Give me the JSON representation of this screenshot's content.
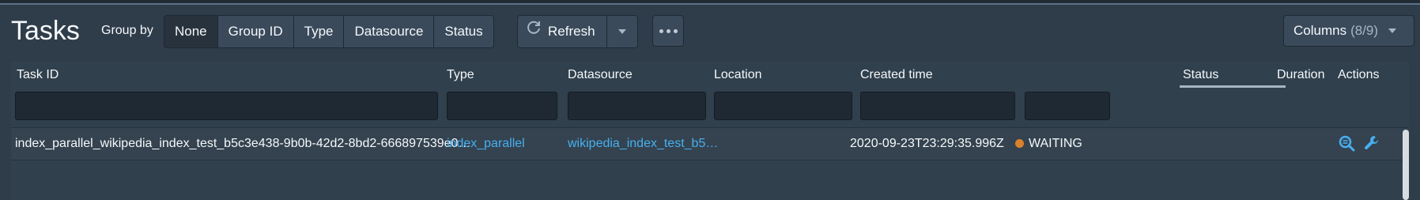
{
  "header": {
    "title": "Tasks",
    "group_by_label": "Group by",
    "group_by_options": [
      "None",
      "Group ID",
      "Type",
      "Datasource",
      "Status"
    ],
    "refresh_label": "Refresh",
    "columns_label": "Columns",
    "columns_count": "(8/9)"
  },
  "table": {
    "columns": [
      "Task ID",
      "Type",
      "Datasource",
      "Location",
      "Created time",
      "Status",
      "Duration",
      "Actions"
    ],
    "rows": [
      {
        "task_id": "index_parallel_wikipedia_index_test_b5c3e438-9b0b-42d2-8bd2-666897539e0…",
        "type": "index_parallel",
        "datasource": "wikipedia_index_test_b5…",
        "location": "",
        "created_time": "2020-09-23T23:29:35.996Z",
        "status": "WAITING",
        "duration": ""
      }
    ]
  },
  "colors": {
    "background": "#2f3c4a",
    "link": "#48aff0",
    "status_waiting": "#d9822b"
  },
  "icons": [
    "refresh-icon",
    "caret-down-icon",
    "more-icon",
    "inspect-icon",
    "wrench-icon"
  ]
}
